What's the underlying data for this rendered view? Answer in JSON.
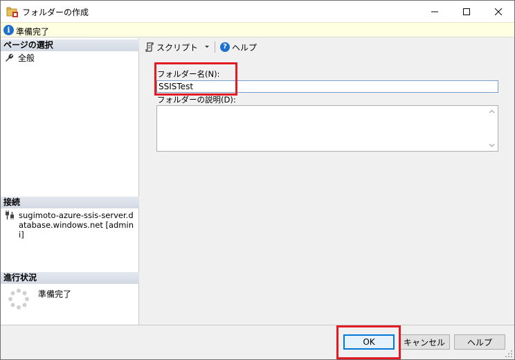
{
  "window": {
    "title": "フォルダーの作成"
  },
  "status": {
    "text": "準備完了"
  },
  "left": {
    "page_header": "ページの選択",
    "pages": [
      {
        "label": "全般"
      }
    ],
    "connection_header": "接続",
    "connection_text": "sugimoto-azure-ssis-server.database.windows.net [admini]",
    "progress_header": "進行状況",
    "progress_text": "準備完了"
  },
  "toolbar": {
    "script_label": "スクリプト",
    "help_label": "ヘルプ"
  },
  "form": {
    "name_label": "フォルダー名(N):",
    "name_value": "SSISTest",
    "desc_label": "フォルダーの説明(D):",
    "desc_value": ""
  },
  "buttons": {
    "ok": "OK",
    "cancel": "キャンセル",
    "help": "ヘルプ"
  },
  "colors": {
    "highlight": "#e21b23",
    "accent": "#0078d7",
    "info_bar": "#ffffe1"
  },
  "icons": [
    "folder-icon",
    "info-icon",
    "wrench-icon",
    "connection-icon",
    "spinner-icon",
    "script-icon",
    "help-icon",
    "minimize-icon",
    "maximize-icon",
    "close-icon"
  ]
}
